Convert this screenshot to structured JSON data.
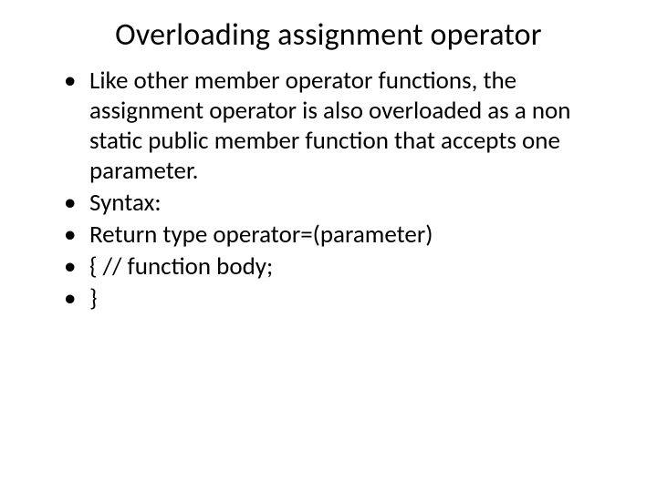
{
  "slide": {
    "title": "Overloading assignment operator",
    "bullets": [
      "Like other member operator functions, the assignment operator is also overloaded as a non static public member function that accepts one parameter.",
      "Syntax:",
      "Return type operator=(parameter)",
      "{ // function body;",
      "}"
    ]
  }
}
